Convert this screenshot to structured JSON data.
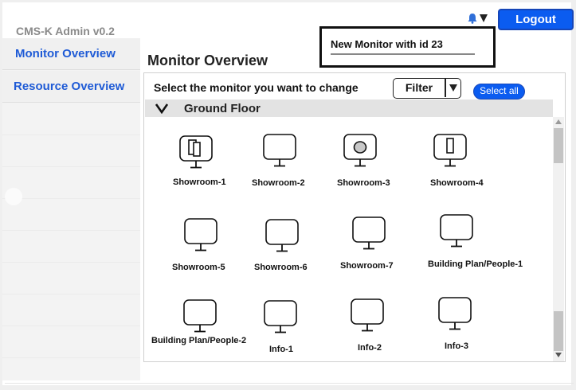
{
  "app": {
    "title": "CMS-K Admin v0.2"
  },
  "sidebar": {
    "items": [
      {
        "label": "Monitor Overview"
      },
      {
        "label": "Resource Overview"
      }
    ]
  },
  "header": {
    "logout_label": "Logout",
    "notification": {
      "text": "New Monitor with id 23"
    }
  },
  "main": {
    "title": "Monitor Overview",
    "instruction": "Select the monitor you want to change",
    "filter_label": "Filter",
    "select_all_label": "Select all",
    "floor": {
      "name": "Ground Floor"
    },
    "monitors": [
      {
        "label": "Showroom-1",
        "icon": "split-screen"
      },
      {
        "label": "Showroom-2",
        "icon": "blank"
      },
      {
        "label": "Showroom-3",
        "icon": "circle"
      },
      {
        "label": "Showroom-4",
        "icon": "portrait"
      },
      {
        "label": "Showroom-5",
        "icon": "blank"
      },
      {
        "label": "Showroom-6",
        "icon": "blank"
      },
      {
        "label": "Showroom-7",
        "icon": "blank"
      },
      {
        "label": "Building Plan/People-1",
        "icon": "blank"
      },
      {
        "label": "Building Plan/People-2",
        "icon": "blank"
      },
      {
        "label": "Info-1",
        "icon": "blank"
      },
      {
        "label": "Info-2",
        "icon": "blank"
      },
      {
        "label": "Info-3",
        "icon": "blank"
      }
    ]
  },
  "colors": {
    "accent": "#0b5cf0",
    "sidebar_link": "#1f5bd6",
    "floor_bar": "#e3e3e3"
  }
}
